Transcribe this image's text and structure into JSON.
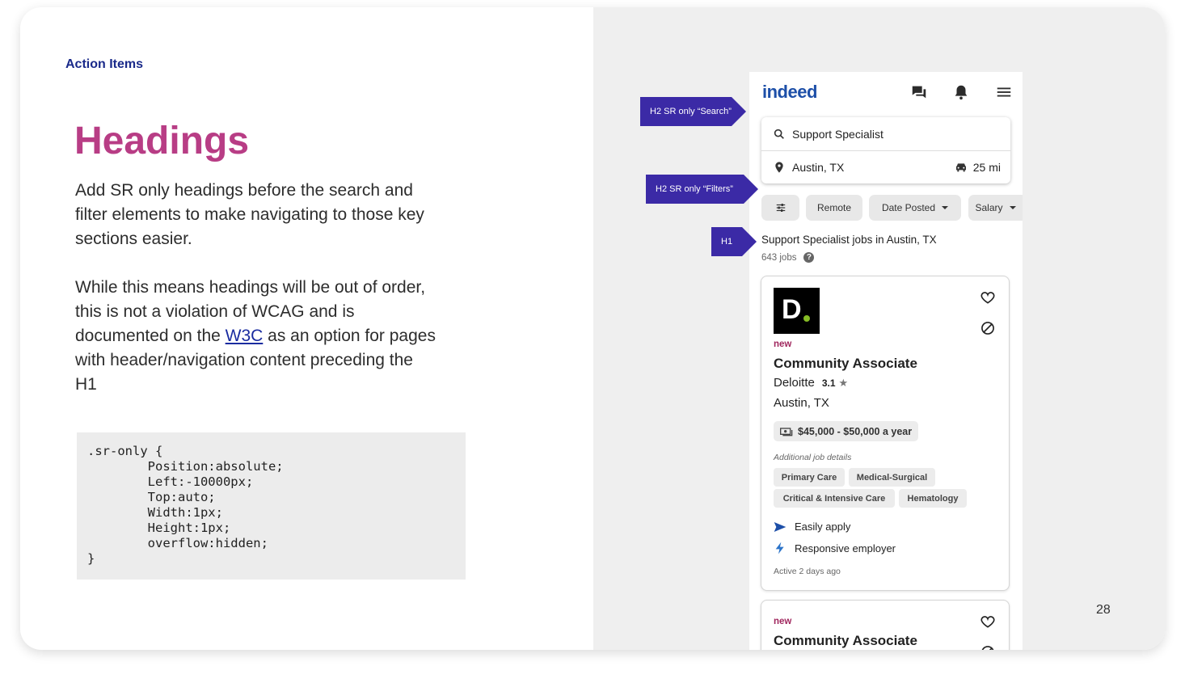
{
  "slide": {
    "eyebrow": "Action Items",
    "title": "Headings",
    "paragraph1": "Add SR only headings before the search and filter elements to make navigating to those key sections easier.",
    "paragraph2_before_link": "While this means headings will be out of order, this is not a violation of WCAG and is documented on the ",
    "paragraph2_link": "W3C",
    "paragraph2_after_link": " as an option for pages with header/navigation content preceding the H1",
    "code": ".sr-only {\n        Position:absolute;\n        Left:-10000px;\n        Top:auto;\n        Width:1px;\n        Height:1px;\n        overflow:hidden;\n}",
    "page_number": "28"
  },
  "callouts": {
    "search": "H2 SR only “Search”",
    "filters": "H2 SR only “Filters”",
    "h1": "H1"
  },
  "app": {
    "logo": "indeed",
    "icons": [
      "chat-icon",
      "bell-icon",
      "menu-icon"
    ],
    "search": {
      "what": "Support Specialist",
      "where": "Austin, TX",
      "distance": "25 mi"
    },
    "filters": [
      "Remote",
      "Date Posted",
      "Salary"
    ],
    "results_title": "Support Specialist jobs in Austin, TX",
    "results_count": "643 jobs",
    "job1": {
      "logo_letter": "D.",
      "badge": "new",
      "title": "Community Associate",
      "company": "Deloitte",
      "rating": "3.1",
      "location": "Austin, TX",
      "salary": "$45,000 - $50,000 a year",
      "additional_label": "Additional job details",
      "tags": [
        "Primary Care",
        "Medical-Surgical",
        "Critical & Intensive Care",
        "Hematology"
      ],
      "feature1": "Easily apply",
      "feature2": "Responsive employer",
      "active": "Active 2 days ago"
    },
    "job2": {
      "badge": "new",
      "title": "Community Associate"
    }
  },
  "colors": {
    "accent_title": "#b83d85",
    "eyebrow": "#1a2a8a",
    "callout": "#3b2aa6",
    "indeed_blue": "#1d4fa8",
    "new_badge": "#a0275e"
  }
}
